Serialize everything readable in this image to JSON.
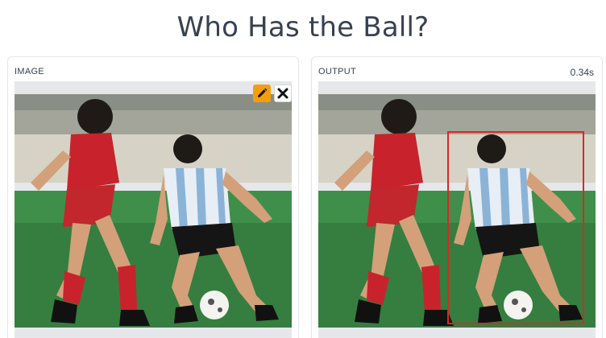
{
  "page": {
    "title": "Who Has the Ball?"
  },
  "input_panel": {
    "label": "IMAGE",
    "edit_icon": "pencil-icon",
    "clear_icon": "close-icon",
    "accent_color": "#f59e0b"
  },
  "output_panel": {
    "label": "OUTPUT",
    "timing": "0.34s",
    "box_color": "#dc2626"
  }
}
